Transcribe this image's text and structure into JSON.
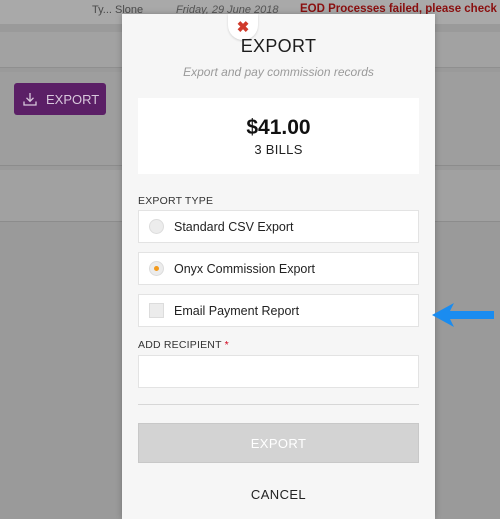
{
  "background": {
    "user_text": "Ty... Slone",
    "date_text": "Friday, 29 June 2018",
    "warning_text": "EOD Processes failed, please check log!",
    "export_button_label": "EXPORT"
  },
  "modal": {
    "close_glyph": "✖",
    "title": "EXPORT",
    "subtitle": "Export and pay commission records",
    "summary": {
      "amount": "$41.00",
      "bills": "3 BILLS"
    },
    "export_type_label": "EXPORT TYPE",
    "options": [
      {
        "label": "Standard CSV Export",
        "selected": false
      },
      {
        "label": "Onyx Commission Export",
        "selected": true
      }
    ],
    "email_report": {
      "label": "Email Payment Report",
      "checked": false
    },
    "recipient": {
      "label": "ADD RECIPIENT",
      "required_mark": "*",
      "value": "",
      "placeholder": ""
    },
    "export_button_label": "EXPORT",
    "cancel_button_label": "CANCEL"
  },
  "colors": {
    "accent_purple": "#5b1f66",
    "radio_selected": "#f39a1c",
    "arrow": "#1a8cf0",
    "warning": "#8a0f0f"
  },
  "icons": [
    "close-icon",
    "download-icon",
    "arrow-left-icon"
  ]
}
